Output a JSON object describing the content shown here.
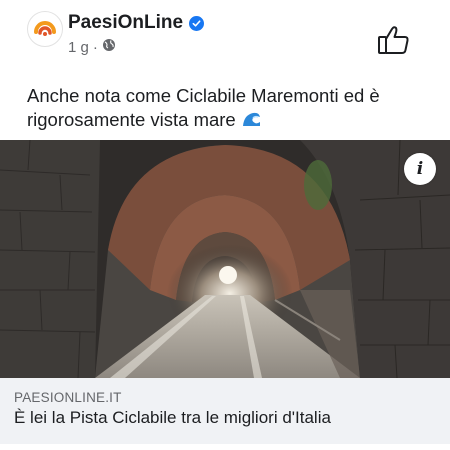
{
  "post": {
    "page_name": "PaesiOnLine",
    "time": "1 g",
    "separator": "·",
    "text": "Anche nota come Ciclabile Maremonti ed è rigorosamente vista mare"
  },
  "link_preview": {
    "domain": "PAESIONLINE.IT",
    "title": "È lei la Pista Ciclabile tra le migliori d'Italia"
  },
  "info_button": {
    "label": "i"
  },
  "icons": [
    "logo-avatar-icon",
    "verified-badge-icon",
    "globe-icon",
    "thumbs-up-icon",
    "wave-emoji-icon",
    "info-icon"
  ],
  "colors": {
    "verified": "#1877f2",
    "text": "#1c1e21",
    "secondary": "#65676b",
    "link_bg": "#f0f2f5"
  }
}
